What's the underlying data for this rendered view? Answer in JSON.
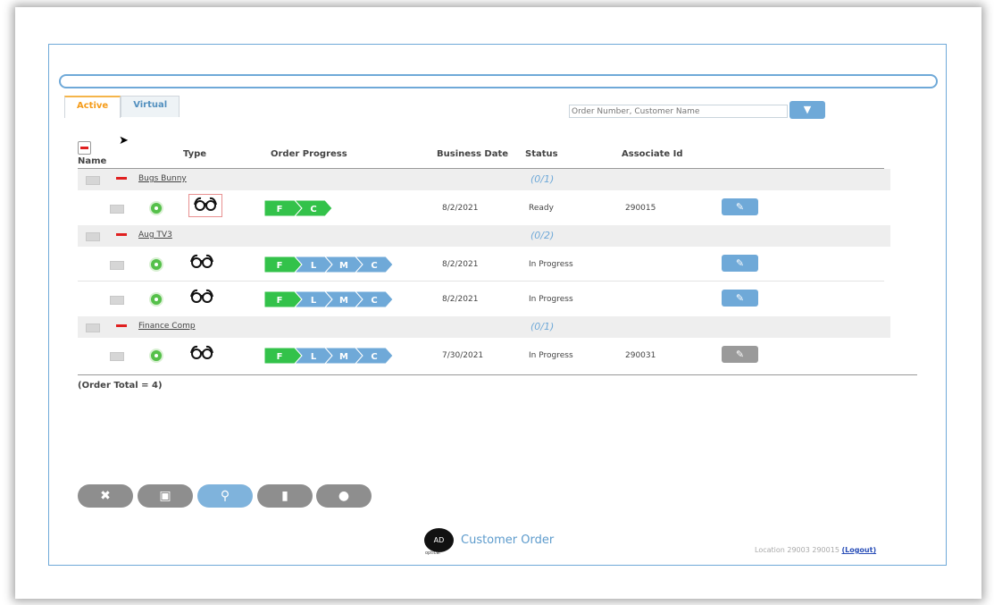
{
  "tabs": [
    {
      "label": "Active",
      "active": true
    },
    {
      "label": "Virtual",
      "active": false
    }
  ],
  "search": {
    "placeholder": "Order Number, Customer Name",
    "filter_icon": "filter-funnel-icon"
  },
  "columns": {
    "name": "Name",
    "type": "Type",
    "progress": "Order Progress",
    "business_date": "Business Date",
    "status": "Status",
    "associate": "Associate Id"
  },
  "groups": [
    {
      "name": "Bugs Bunny",
      "count": "(0/1)",
      "orders": [
        {
          "type_icon": "eyeglasses-icon",
          "progress": [
            "F",
            "C"
          ],
          "completed": 2,
          "date": "8/2/2021",
          "status": "Ready",
          "associate": "290015",
          "edit_active": true
        }
      ]
    },
    {
      "name": "Aug TV3",
      "count": "(0/2)",
      "orders": [
        {
          "type_icon": "eyeglasses-icon",
          "progress": [
            "F",
            "L",
            "M",
            "C"
          ],
          "completed": 1,
          "date": "8/2/2021",
          "status": "In Progress",
          "associate": "",
          "edit_active": true
        },
        {
          "type_icon": "eyeglasses-icon",
          "progress": [
            "F",
            "L",
            "M",
            "C"
          ],
          "completed": 1,
          "date": "8/2/2021",
          "status": "In Progress",
          "associate": "",
          "edit_active": true
        }
      ]
    },
    {
      "name": "Finance Comp",
      "count": "(0/1)",
      "orders": [
        {
          "type_icon": "eyeglasses-icon",
          "progress": [
            "F",
            "L",
            "M",
            "C"
          ],
          "completed": 1,
          "date": "7/30/2021",
          "status": "In Progress",
          "associate": "290031",
          "edit_active": false
        }
      ]
    }
  ],
  "order_total": "(Order Total = 4)",
  "toolbar": [
    {
      "icon": "close-icon",
      "glyph": "✖"
    },
    {
      "icon": "calendar-icon",
      "glyph": "▣"
    },
    {
      "icon": "search-icon",
      "glyph": "⚲"
    },
    {
      "icon": "calculator-icon",
      "glyph": "▮"
    },
    {
      "icon": "chat-icon",
      "glyph": "●"
    }
  ],
  "footer": {
    "logo_text": "AD",
    "logo_sub": "optical",
    "app_title": "Customer Order",
    "location": "Location 29003  290015 ",
    "logout": "(Logout)"
  },
  "colors": {
    "green": "#33c24a",
    "blue": "#6fa9d8",
    "accent": "#f59c1a"
  }
}
